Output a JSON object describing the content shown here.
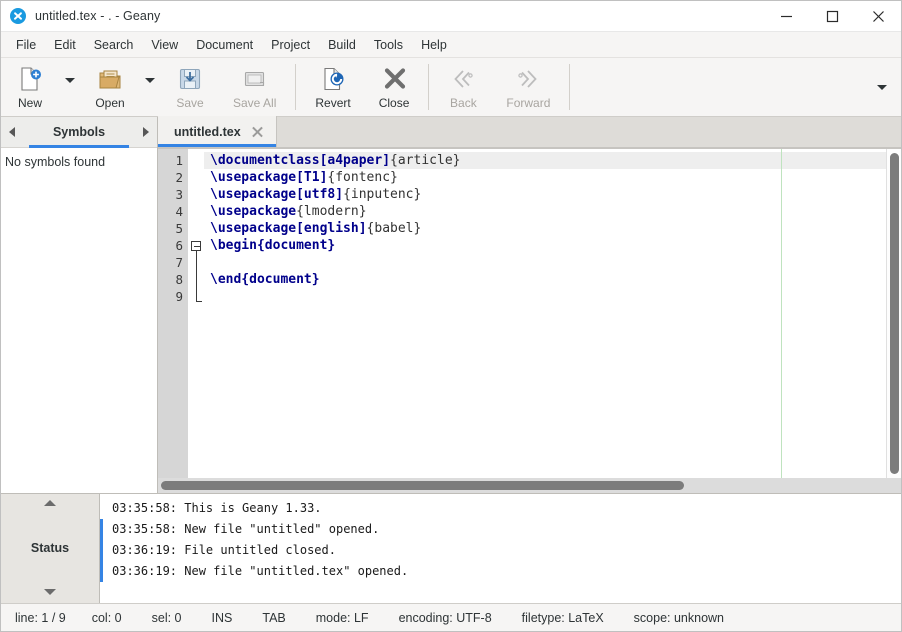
{
  "window": {
    "title": "untitled.tex - . - Geany",
    "icon": "geany-logo-icon",
    "controls": {
      "minimize": "minimize",
      "maximize": "maximize",
      "close": "close"
    }
  },
  "menubar": {
    "items": [
      "File",
      "Edit",
      "Search",
      "View",
      "Document",
      "Project",
      "Build",
      "Tools",
      "Help"
    ]
  },
  "toolbar": {
    "items": [
      {
        "label": "New",
        "icon": "new-file-icon",
        "enabled": true,
        "has_menu": true
      },
      {
        "label": "Open",
        "icon": "open-folder-icon",
        "enabled": true,
        "has_menu": true
      },
      {
        "label": "Save",
        "icon": "save-disk-icon",
        "enabled": false,
        "has_menu": false
      },
      {
        "label": "Save All",
        "icon": "save-all-icon",
        "enabled": false,
        "has_menu": false
      },
      {
        "label": "Revert",
        "icon": "revert-icon",
        "enabled": true,
        "has_menu": false
      },
      {
        "label": "Close",
        "icon": "close-x-icon",
        "enabled": true,
        "has_menu": false
      },
      {
        "label": "Back",
        "icon": "back-arrow-icon",
        "enabled": false,
        "has_menu": false
      },
      {
        "label": "Forward",
        "icon": "forward-arrow-icon",
        "enabled": false,
        "has_menu": false
      }
    ],
    "overflow_icon": "chevron-down-icon"
  },
  "sidebar": {
    "tab_label": "Symbols",
    "prev_icon": "chevron-left-icon",
    "next_icon": "chevron-right-icon",
    "empty_message": "No symbols found"
  },
  "document_tabs": [
    {
      "label": "untitled.tex",
      "close_icon": "close-icon",
      "active": true
    }
  ],
  "editor": {
    "line_numbers": [
      "1",
      "2",
      "3",
      "4",
      "5",
      "6",
      "7",
      "8",
      "9"
    ],
    "current_line": 1,
    "lines": [
      {
        "n": 1,
        "tokens": [
          {
            "t": "cmd",
            "s": "\\documentclass"
          },
          {
            "t": "opt",
            "s": "[a4paper]"
          },
          {
            "t": "txt",
            "s": "{article}"
          }
        ]
      },
      {
        "n": 2,
        "tokens": [
          {
            "t": "cmd",
            "s": "\\usepackage"
          },
          {
            "t": "opt",
            "s": "[T1]"
          },
          {
            "t": "txt",
            "s": "{fontenc}"
          }
        ]
      },
      {
        "n": 3,
        "tokens": [
          {
            "t": "cmd",
            "s": "\\usepackage"
          },
          {
            "t": "opt",
            "s": "[utf8]"
          },
          {
            "t": "txt",
            "s": "{inputenc}"
          }
        ]
      },
      {
        "n": 4,
        "tokens": [
          {
            "t": "cmd",
            "s": "\\usepackage"
          },
          {
            "t": "txt",
            "s": "{lmodern}"
          }
        ]
      },
      {
        "n": 5,
        "tokens": [
          {
            "t": "cmd",
            "s": "\\usepackage"
          },
          {
            "t": "opt",
            "s": "[english]"
          },
          {
            "t": "txt",
            "s": "{babel}"
          }
        ]
      },
      {
        "n": 6,
        "tokens": [
          {
            "t": "cmd",
            "s": "\\begin{document}"
          }
        ]
      },
      {
        "n": 7,
        "tokens": []
      },
      {
        "n": 8,
        "tokens": [
          {
            "t": "cmd",
            "s": "\\end{document}"
          }
        ]
      },
      {
        "n": 9,
        "tokens": []
      }
    ],
    "fold_point_line": 6,
    "long_line_marker_color": "#bfe3bf"
  },
  "message_window": {
    "tab_label": "Status",
    "scroll_up_icon": "triangle-up-icon",
    "scroll_down_icon": "triangle-down-icon",
    "rows": [
      {
        "text": "03:35:58: This is Geany 1.33.",
        "marked": false
      },
      {
        "text": "03:35:58: New file \"untitled\" opened.",
        "marked": true
      },
      {
        "text": "03:36:19: File untitled closed.",
        "marked": true
      },
      {
        "text": "03:36:19: New file \"untitled.tex\" opened.",
        "marked": true
      }
    ]
  },
  "statusbar": {
    "line": "line: 1 / 9",
    "col": "col: 0",
    "sel": "sel: 0",
    "insert_mode": "INS",
    "indent_mode": "TAB",
    "eol_mode": "mode: LF",
    "encoding": "encoding: UTF-8",
    "filetype": "filetype: LaTeX",
    "scope": "scope: unknown"
  },
  "colors": {
    "accent": "#3584e4",
    "chrome": "#f6f5f4",
    "keyword": "#00008b",
    "text": "#333333"
  }
}
